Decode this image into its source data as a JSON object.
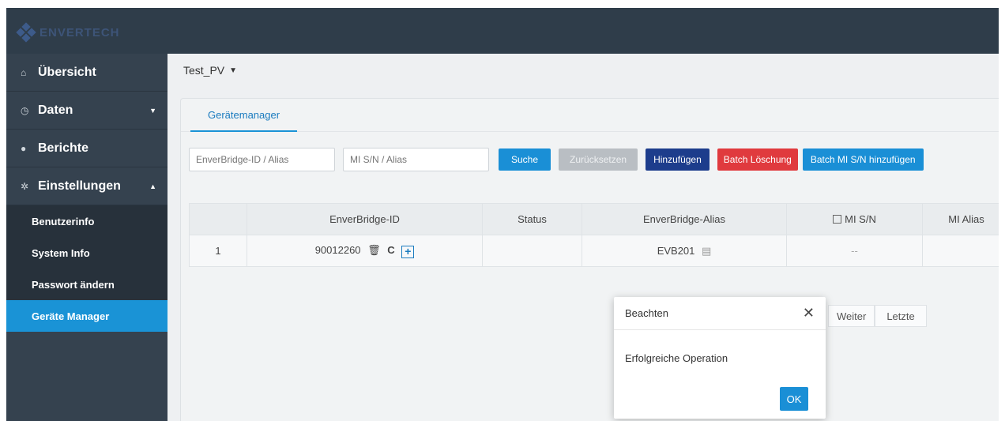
{
  "brand": {
    "logo_text": "ENVERTECH"
  },
  "sidebar": {
    "items": [
      {
        "label": "Übersicht",
        "icon": "home-icon"
      },
      {
        "label": "Daten",
        "icon": "clock-icon"
      },
      {
        "label": "Berichte",
        "icon": "database-icon"
      },
      {
        "label": "Einstellungen",
        "icon": "gear-icon"
      }
    ],
    "sub_items": [
      {
        "label": "Benutzerinfo"
      },
      {
        "label": "System Info"
      },
      {
        "label": "Passwort ändern"
      },
      {
        "label": "Geräte Manager"
      }
    ]
  },
  "plant": {
    "name": "Test_PV"
  },
  "tab": {
    "label": "Gerätemanager"
  },
  "filters": {
    "bridge_placeholder": "EnverBridge-ID / Alias",
    "mi_placeholder": "MI S/N / Alias"
  },
  "toolbar": {
    "search": "Suche",
    "reset": "Zurücksetzen",
    "add": "Hinzufügen",
    "batch_delete": "Batch Löschung",
    "batch_add_mi": "Batch MI S/N hinzufügen"
  },
  "table": {
    "headers": [
      "",
      "EnverBridge-ID",
      "Status",
      "EnverBridge-Alias",
      "MI S/N",
      "MI Alias"
    ],
    "rows": [
      {
        "index": "1",
        "bridge_id": "90012260",
        "status": "",
        "alias": "EVB201",
        "mi_sn": "--",
        "mi_alias": ""
      }
    ]
  },
  "pager": {
    "next": "Weiter",
    "last": "Letzte"
  },
  "modal": {
    "title": "Beachten",
    "message": "Erfolgreiche Operation",
    "ok": "OK"
  },
  "colors": {
    "accent": "#1a93d6",
    "sidebar": "#35424f",
    "topbar": "#2f3d4a"
  }
}
